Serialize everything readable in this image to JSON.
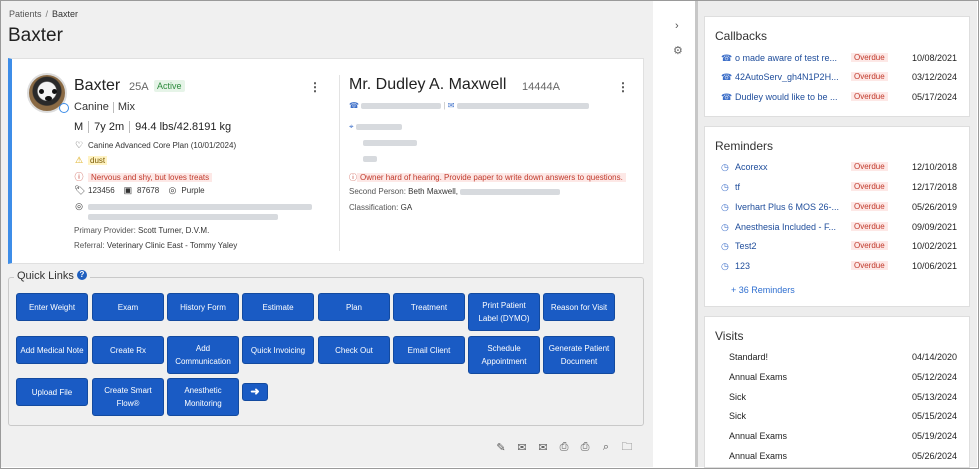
{
  "breadcrumb": {
    "parent": "Patients",
    "separator": "/",
    "current": "Baxter"
  },
  "page_title": "Baxter",
  "patient": {
    "name": "Baxter",
    "id": "25A",
    "status": "Active",
    "species": "Canine",
    "breed": "Mix",
    "sex": "M",
    "age": "7y 2m",
    "weight": "94.4 lbs/42.8191 kg",
    "plan": "Canine Advanced Core Plan (10/01/2024)",
    "allergy": "dust",
    "alert": "Nervous and shy, but loves treats",
    "tag": "123456",
    "microchip": "87678",
    "color": "Purple",
    "primary_provider_label": "Primary Provider:",
    "primary_provider": "Scott Turner, D.V.M.",
    "referral_label": "Referral:",
    "referral": "Veterinary Clinic East - Tommy Yaley"
  },
  "owner": {
    "name": "Mr. Dudley A. Maxwell",
    "id": "14444A",
    "alert": "Owner hard of hearing. Provide paper to write down answers to questions.",
    "second_person_label": "Second Person:",
    "second_person": "Beth Maxwell,",
    "classification_label": "Classification:",
    "classification": "GA"
  },
  "quick_links": {
    "title": "Quick Links",
    "help": "?",
    "buttons": [
      "Enter Weight",
      "Exam",
      "History Form",
      "Estimate",
      "Plan",
      "Treatment",
      "Print Patient Label (DYMO)",
      "Reason for Visit",
      "Add Medical Note",
      "Create Rx",
      "Add Communication",
      "Quick Invoicing",
      "Check Out",
      "Email Client",
      "Schedule Appointment",
      "Generate Patient Document",
      "Upload File",
      "Create Smart Flow®",
      "Anesthetic Monitoring",
      "➜"
    ]
  },
  "icons": {
    "edit_icon": "✎",
    "email_icon": "✉",
    "email_multi_icon": "✉",
    "print_icon": "⎙",
    "print_label_icon": "⎙",
    "search_icon": "⌕",
    "folder_icon": "🗀",
    "collapse_icon": "›",
    "settings_icon": "⚙",
    "phone_icon": "☎",
    "clock_icon": "◷",
    "heart_icon": "♡",
    "warning_icon": "⚠",
    "alert_icon": "ⓘ",
    "tag_icon": "🏷",
    "chip_icon": "▣",
    "palette_icon": "◎",
    "pin_icon": "⌖",
    "kebab_icon": "⋮"
  },
  "callbacks": {
    "title": "Callbacks",
    "items": [
      {
        "text": "o made aware of test re...",
        "status": "Overdue",
        "date": "10/08/2021"
      },
      {
        "text": "42AutoServ_gh4N1P2H...",
        "status": "Overdue",
        "date": "03/12/2024"
      },
      {
        "text": "Dudley would like to be ...",
        "status": "Overdue",
        "date": "05/17/2024"
      }
    ]
  },
  "reminders": {
    "title": "Reminders",
    "items": [
      {
        "text": "Acorexx",
        "status": "Overdue",
        "date": "12/10/2018"
      },
      {
        "text": "tf",
        "status": "Overdue",
        "date": "12/17/2018"
      },
      {
        "text": "Iverhart Plus 6 MOS 26-...",
        "status": "Overdue",
        "date": "05/26/2019"
      },
      {
        "text": "Anesthesia Included - F...",
        "status": "Overdue",
        "date": "09/09/2021"
      },
      {
        "text": "Test2",
        "status": "Overdue",
        "date": "10/02/2021"
      },
      {
        "text": "123",
        "status": "Overdue",
        "date": "10/06/2021"
      }
    ],
    "more": "+ 36 Reminders"
  },
  "visits": {
    "title": "Visits",
    "items": [
      {
        "type": "Standard!",
        "date": "04/14/2020"
      },
      {
        "type": "Annual Exams",
        "date": "05/12/2024"
      },
      {
        "type": "Sick",
        "date": "05/13/2024"
      },
      {
        "type": "Sick",
        "date": "05/15/2024"
      },
      {
        "type": "Annual Exams",
        "date": "05/19/2024"
      },
      {
        "type": "Annual Exams",
        "date": "05/26/2024"
      }
    ]
  },
  "colors": {
    "accent": "#1a5bc4",
    "card_border": "#3d8de8",
    "overdue": "#c0392b",
    "active": "#2e8b3e"
  }
}
